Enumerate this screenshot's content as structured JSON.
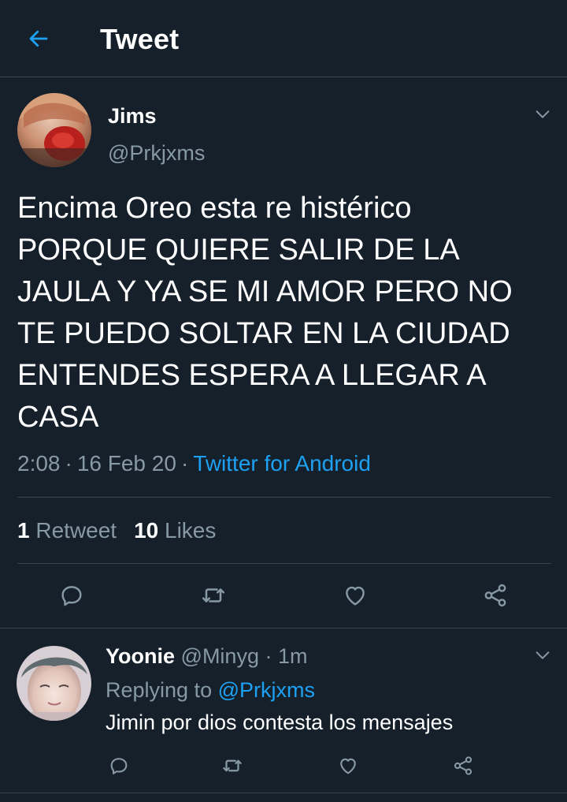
{
  "header": {
    "title": "Tweet",
    "back_icon": "arrow-left-icon",
    "accent_color": "#1da1f2"
  },
  "tweet": {
    "author_name": "Jims",
    "author_handle": "@Prkjxms",
    "text": "Encima Oreo esta re histérico\nPORQUE QUIERE SALIR DE LA\nJAULA Y YA SE MI AMOR PERO NO\nTE PUEDO SOLTAR EN LA CIUDAD\nENTENDES ESPERA A LLEGAR A\nCASA",
    "time": "2:08",
    "date": "16 Feb 20",
    "separator": "·",
    "source": "Twitter for Android",
    "retweet_count": "1",
    "retweet_label": "Retweet",
    "like_count": "10",
    "like_label": "Likes"
  },
  "actions": {
    "icons": [
      "reply-icon",
      "retweet-icon",
      "like-icon",
      "share-icon"
    ]
  },
  "reply": {
    "author_name": "Yoonie",
    "author_handle": "@Minyg",
    "separator": "·",
    "time": "1m",
    "replying_to_label": "Replying to",
    "replying_to_handle": "@Prkjxms",
    "text": "Jimin por dios contesta los mensajes"
  },
  "colors": {
    "background": "#15202b",
    "border": "#38444d",
    "secondary_text": "#8899a6",
    "link": "#1da1f2"
  }
}
